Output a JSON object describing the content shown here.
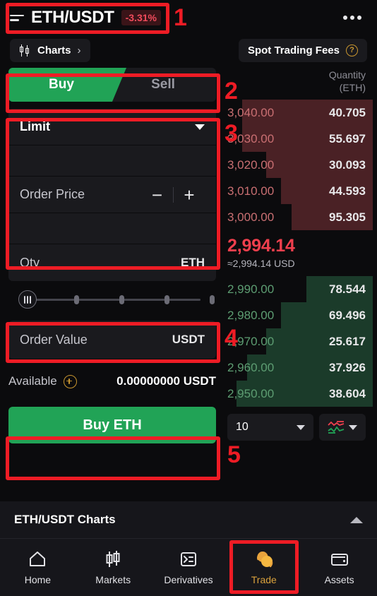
{
  "header": {
    "menu_icon": "hamburger-icon",
    "pair": "ETH/USDT",
    "change_pct": "-3.31%",
    "more_icon": "more-options-icon"
  },
  "subheader": {
    "charts_label": "Charts",
    "charts_icon": "candlestick-icon",
    "chevron": "›",
    "fees_label": "Spot Trading Fees",
    "help_icon": "?"
  },
  "tabs": {
    "buy": "Buy",
    "sell": "Sell",
    "active": "Buy"
  },
  "order_form": {
    "order_type": "Limit",
    "order_price_label": "Order Price",
    "order_price_value": "",
    "minus": "−",
    "plus": "+",
    "qty_label": "Qty",
    "qty_value": "",
    "qty_unit": "ETH",
    "order_value_label": "Order Value",
    "order_value_value": "",
    "order_value_unit": "USDT"
  },
  "slider": {
    "handle_position_pct": 0,
    "ticks": [
      25,
      50,
      75,
      100
    ]
  },
  "available": {
    "label": "Available",
    "add_icon": "plus-circle-icon",
    "value": "0.00000000 USDT"
  },
  "submit": {
    "label": "Buy ETH"
  },
  "orderbook": {
    "qty_header_line1": "Quantity",
    "qty_header_line2": "(ETH)",
    "asks": [
      {
        "price": "3,040.00",
        "qty": "40.705",
        "depth_pct": 88
      },
      {
        "price": "3,030.00",
        "qty": "55.697",
        "depth_pct": 88
      },
      {
        "price": "3,020.00",
        "qty": "30.093",
        "depth_pct": 72
      },
      {
        "price": "3,010.00",
        "qty": "44.593",
        "depth_pct": 62
      },
      {
        "price": "3,000.00",
        "qty": "95.305",
        "depth_pct": 55
      }
    ],
    "bids": [
      {
        "price": "2,990.00",
        "qty": "78.544",
        "depth_pct": 45
      },
      {
        "price": "2,980.00",
        "qty": "69.496",
        "depth_pct": 62
      },
      {
        "price": "2,970.00",
        "qty": "25.617",
        "depth_pct": 72
      },
      {
        "price": "2,960.00",
        "qty": "37.926",
        "depth_pct": 85
      },
      {
        "price": "2,950.00",
        "qty": "38.604",
        "depth_pct": 92
      }
    ],
    "last_price": "2,994.14",
    "last_price_usd": "≈2,994.14 USD",
    "grouping": "10",
    "view_icon": "depth-chart-icon"
  },
  "charts_footer": {
    "title": "ETH/USDT Charts",
    "collapse_icon": "chevron-up-icon"
  },
  "bottom_nav": [
    {
      "label": "Home",
      "icon": "home-icon",
      "active": false
    },
    {
      "label": "Markets",
      "icon": "candlestick-icon",
      "active": false
    },
    {
      "label": "Derivatives",
      "icon": "list-terminal-icon",
      "active": false
    },
    {
      "label": "Trade",
      "icon": "coins-icon",
      "active": true
    },
    {
      "label": "Assets",
      "icon": "wallet-icon",
      "active": false
    }
  ],
  "annotations": [
    {
      "number": "1"
    },
    {
      "number": "2"
    },
    {
      "number": "3"
    },
    {
      "number": "4"
    },
    {
      "number": "5"
    }
  ],
  "colors": {
    "buy_green": "#21a356",
    "sell_red": "#ef3f4d",
    "accent_gold": "#d9a13c",
    "annotation_red": "#ee1c25",
    "background": "#0b0b0d",
    "panel": "#1a1a1e"
  }
}
